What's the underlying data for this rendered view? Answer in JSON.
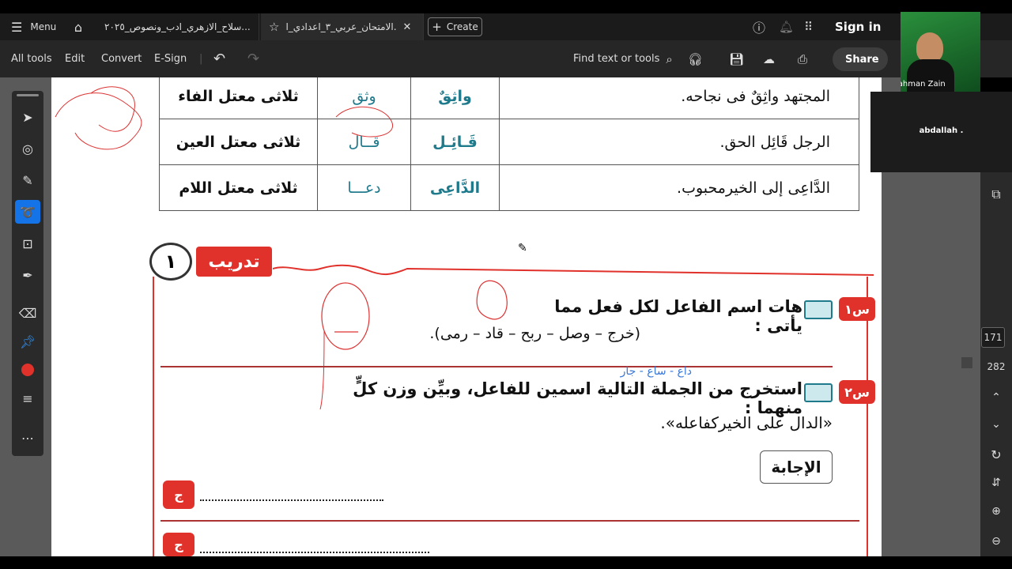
{
  "tabs": {
    "menu_label": "Menu",
    "tab1_title": "سلاح_الازهري_ادب_ونصوص_٢٠٢٥...",
    "tab2_title": "الامتحان_عربي_٣_اعدادي_ا...",
    "create_label": "Create",
    "sign_in": "Sign in"
  },
  "toolbar": {
    "all_tools": "All tools",
    "edit": "Edit",
    "convert": "Convert",
    "esign": "E-Sign",
    "find": "Find text or tools",
    "share": "Share"
  },
  "table_rows": [
    {
      "sentence": "المجتهد واثِقٌ فى نجاحه.",
      "fa3il": "واثِقٌ",
      "verb": "وثق",
      "type": "ثلاثى معتل الفاء"
    },
    {
      "sentence": "الرجل قَائِل الحق.",
      "fa3il": "قَـائِـل",
      "verb": "قــال",
      "type": "ثلاثى معتل العين"
    },
    {
      "sentence": "الدَّاعِى إلى الخيرمحبوب.",
      "fa3il": "الدَّاعِى",
      "verb": "دعـــا",
      "type": "ثلاثى معتل اللام"
    }
  ],
  "training": {
    "label": "تدريب",
    "number": "١"
  },
  "q1": {
    "badge": "س١",
    "text": "هات اسم الفاعل لكل فعل مما يأتى :",
    "verbs": "(خرج – وصل – ربح – قاد – رمى)."
  },
  "q2": {
    "badge": "س٢",
    "annotation": "داع - ساع - جار",
    "text": "استخرج من الجملة التالية اسمين للفاعل، وبيِّن وزن كلٍّ منهما :",
    "quote": "«الدال على الخيركفاعله»."
  },
  "answer_label": "الإجابة",
  "answer_badge": "ج",
  "page_numbers": {
    "current": "171",
    "total": "282"
  },
  "webcam": {
    "name": "Abdulrahman Zain",
    "participant": "abdallah ."
  },
  "colors": {
    "accent": "#1473e6",
    "red": "#e0312b",
    "teal": "#1f7a8c"
  }
}
